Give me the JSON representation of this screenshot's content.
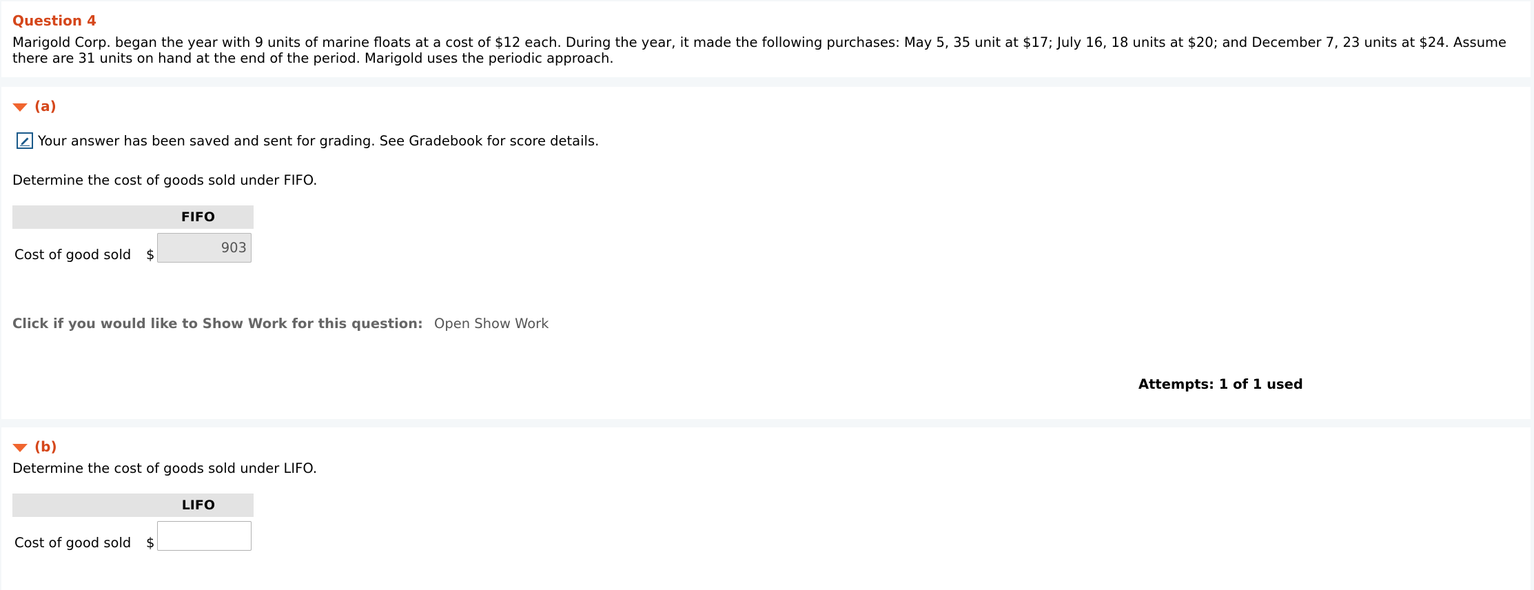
{
  "question": {
    "title": "Question 4",
    "text": "Marigold Corp. began the year with 9 units of marine floats at a cost of $12 each. During the year, it made the following purchases: May 5, 35 unit at $17; July 16, 18 units at $20; and December 7, 23 units at $24. Assume there are 31 units on hand at the end of the period. Marigold uses the periodic approach."
  },
  "part_a": {
    "label": "(a)",
    "saved_message": "Your answer has been saved and sent for grading. See Gradebook for score details.",
    "prompt": "Determine the cost of goods sold under FIFO.",
    "column_header": "FIFO",
    "row_label": "Cost of good sold",
    "currency": "$",
    "answer_value": "903",
    "show_work_label": "Click if you would like to Show Work for this question:",
    "show_work_link": "Open Show Work",
    "attempts": "Attempts: 1 of 1 used"
  },
  "part_b": {
    "label": "(b)",
    "prompt": "Determine the cost of goods sold under LIFO.",
    "column_header": "LIFO",
    "row_label": "Cost of good sold",
    "currency": "$",
    "answer_value": ""
  },
  "icons": {
    "collapse_a": "triangle-down-icon",
    "collapse_b": "triangle-down-icon",
    "saved": "edit-pencil-icon"
  },
  "colors": {
    "accent": "#d5471b",
    "triangle": "#f0652f",
    "icon_border": "#1a5a8a"
  }
}
